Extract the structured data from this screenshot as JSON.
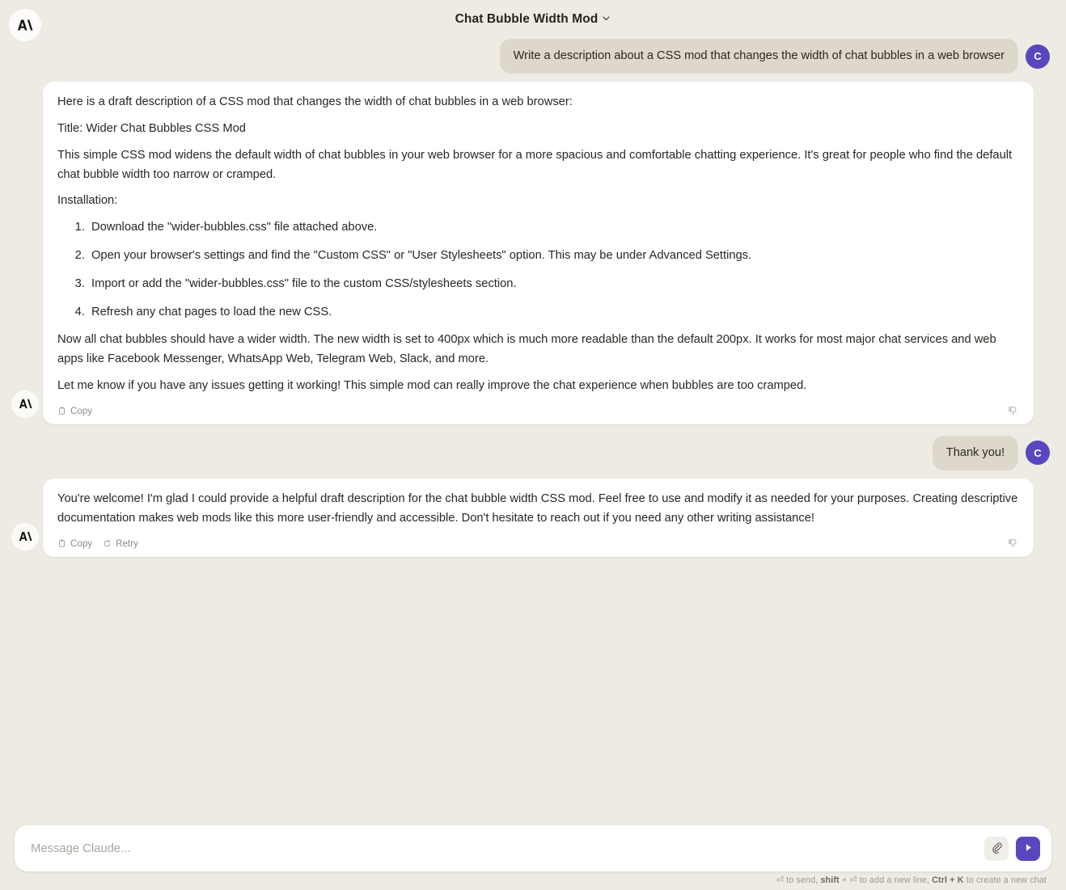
{
  "header": {
    "logo_alt": "Anthropic logo",
    "title": "Chat Bubble Width Mod",
    "chevron": "chevron-down"
  },
  "conversation": [
    {
      "role": "user",
      "avatar_initial": "C",
      "text": "Write a description about a CSS mod that changes the width of chat bubbles in a web browser"
    },
    {
      "role": "assistant",
      "paragraphs": {
        "intro": "Here is a draft description of a CSS mod that changes the width of chat bubbles in a web browser:",
        "title_line": "Title: Wider Chat Bubbles CSS Mod",
        "summary": "This simple CSS mod widens the default width of chat bubbles in your web browser for a more spacious and comfortable chatting experience. It's great for people who find the default chat bubble width too narrow or cramped.",
        "install_label": "Installation:",
        "closing_1": "Now all chat bubbles should have a wider width. The new width is set to 400px which is much more readable than the default 200px. It works for most major chat services and web apps like Facebook Messenger, WhatsApp Web, Telegram Web, Slack, and more.",
        "closing_2": "Let me know if you have any issues getting it working! This simple mod can really improve the chat experience when bubbles are too cramped."
      },
      "steps": [
        "Download the \"wider-bubbles.css\" file attached above.",
        "Open your browser's settings and find the \"Custom CSS\" or \"User Stylesheets\" option. This may be under Advanced Settings.",
        "Import or add the \"wider-bubbles.css\" file to the custom CSS/stylesheets section.",
        "Refresh any chat pages to load the new CSS."
      ],
      "actions": {
        "copy": "Copy",
        "retry": null,
        "feedback": "thumbs-down"
      }
    },
    {
      "role": "user",
      "avatar_initial": "C",
      "text": "Thank you!"
    },
    {
      "role": "assistant",
      "paragraphs": {
        "body": "You're welcome! I'm glad I could provide a helpful draft description for the chat bubble width CSS mod. Feel free to use and modify it as needed for your purposes. Creating descriptive documentation makes web mods like this more user-friendly and accessible. Don't hesitate to reach out if you need any other writing assistance!"
      },
      "actions": {
        "copy": "Copy",
        "retry": "Retry",
        "feedback": "thumbs-down"
      }
    }
  ],
  "composer": {
    "placeholder": "Message Claude...",
    "value": "",
    "attach_icon": "paperclip-icon",
    "send_icon": "send-icon",
    "hint": {
      "enter_glyph": "⏎",
      "part1": " to send, ",
      "shift_label": "shift",
      "plus": " + ",
      "part2": " to add a new line, ",
      "ctrl_k_label": "Ctrl + K",
      "part3": " to create a new chat"
    }
  },
  "colors": {
    "background": "#edebe3",
    "card": "#ffffff",
    "user_bubble": "#ddd8cb",
    "accent_purple": "#5a47bd",
    "text": "#2a2722",
    "muted": "#8d8a82"
  }
}
